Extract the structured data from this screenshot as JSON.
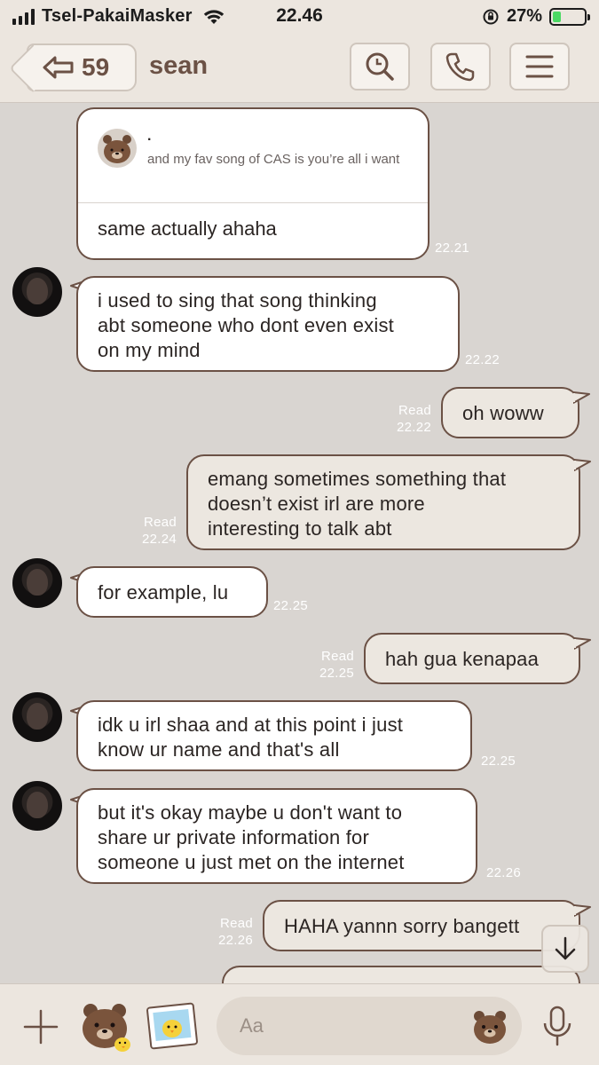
{
  "status_bar": {
    "carrier": "Tsel-PakaiMasker",
    "time": "22.46",
    "battery": "27%",
    "battery_level": 0.27
  },
  "header": {
    "back_count": "59",
    "title": "sean",
    "icons": [
      "back-arrow-icon",
      "search-icon",
      "phone-icon",
      "menu-icon"
    ]
  },
  "messages": [
    {
      "id": "m1",
      "direction": "in",
      "reply_to": {
        "author": ".",
        "text": "and my fav song of CAS is you’re all i want"
      },
      "text": "same actually ahaha",
      "time": "22.21"
    },
    {
      "id": "m2",
      "direction": "in",
      "lines": [
        "i used to sing that song thinking",
        "abt someone who dont even exist",
        "on my mind"
      ],
      "time": "22.22"
    },
    {
      "id": "m3",
      "direction": "out",
      "text": "oh woww",
      "read": "Read",
      "time": "22.22"
    },
    {
      "id": "m4",
      "direction": "out",
      "lines": [
        "emang sometimes something that",
        "doesn’t exist irl are more",
        "interesting to talk abt"
      ],
      "read": "Read",
      "time": "22.24"
    },
    {
      "id": "m5",
      "direction": "in",
      "text": "for example, lu",
      "time": "22.25"
    },
    {
      "id": "m6",
      "direction": "out",
      "text": "hah gua kenapaa",
      "read": "Read",
      "time": "22.25"
    },
    {
      "id": "m7",
      "direction": "in",
      "lines": [
        "idk u irl shaa and at this point i just",
        "know ur name and that's all"
      ],
      "time": "22.25"
    },
    {
      "id": "m8",
      "direction": "in",
      "lines": [
        "but it's okay maybe u don't want to",
        "share ur private information for",
        "someone u just met on the internet"
      ],
      "time": "22.26"
    },
    {
      "id": "m9",
      "direction": "out",
      "text": "HAHA yannn sorry bangett",
      "read": "Read",
      "time": "22.26"
    }
  ],
  "input_bar": {
    "placeholder": "Aa",
    "icons": [
      "plus-icon",
      "sticker-icon",
      "photo-icon",
      "emoji-icon",
      "microphone-icon"
    ]
  },
  "colors": {
    "background": "#d9d5d1",
    "bubble_border": "#6b5145",
    "bubble_in": "#ffffff",
    "bubble_out": "#ece7e0",
    "header": "#ece6df",
    "accent_text": "#6b5145"
  }
}
